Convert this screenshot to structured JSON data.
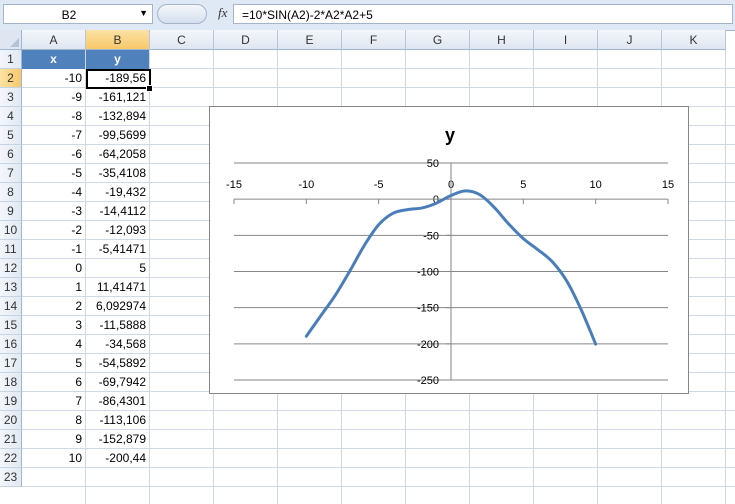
{
  "formula_bar": {
    "name_box": "B2",
    "fx_label": "fx",
    "formula": "=10*SIN(A2)-2*A2*A2+5"
  },
  "columns": [
    "A",
    "B",
    "C",
    "D",
    "E",
    "F",
    "G",
    "H",
    "I",
    "J",
    "K"
  ],
  "selected_column": "B",
  "selected_row": 2,
  "rows": [
    "1",
    "2",
    "3",
    "4",
    "5",
    "6",
    "7",
    "8",
    "9",
    "10",
    "11",
    "12",
    "13",
    "14",
    "15",
    "16",
    "17",
    "18",
    "19",
    "20",
    "21",
    "22",
    "23"
  ],
  "table": {
    "headers": [
      "x",
      "y"
    ],
    "x_values": [
      "-10",
      "-9",
      "-8",
      "-7",
      "-6",
      "-5",
      "-4",
      "-3",
      "-2",
      "-1",
      "0",
      "1",
      "2",
      "3",
      "4",
      "5",
      "6",
      "7",
      "8",
      "9",
      "10"
    ],
    "y_values": [
      "-189,56",
      "-161,121",
      "-132,894",
      "-99,5699",
      "-64,2058",
      "-35,4108",
      "-19,432",
      "-14,4112",
      "-12,093",
      "-5,41471",
      "5",
      "11,41471",
      "6,092974",
      "-11,5888",
      "-34,568",
      "-54,5892",
      "-69,7942",
      "-86,4301",
      "-113,106",
      "-152,879",
      "-200,44"
    ]
  },
  "colors": {
    "header_fill": "#4f81bd",
    "series": "#4a7ebb"
  },
  "chart_data": {
    "type": "scatter",
    "smooth": true,
    "title": "y",
    "xlabel": "",
    "ylabel": "",
    "x": [
      -10,
      -9,
      -8,
      -7,
      -6,
      -5,
      -4,
      -3,
      -2,
      -1,
      0,
      1,
      2,
      3,
      4,
      5,
      6,
      7,
      8,
      9,
      10
    ],
    "y": [
      -189.56,
      -161.121,
      -132.894,
      -99.5699,
      -64.2058,
      -35.4108,
      -19.432,
      -14.4112,
      -12.093,
      -5.41471,
      5,
      11.41471,
      6.092974,
      -11.5888,
      -34.568,
      -54.5892,
      -69.7942,
      -86.4301,
      -113.106,
      -152.879,
      -200.44
    ],
    "xlim": [
      -15,
      15
    ],
    "ylim": [
      -250,
      50
    ],
    "x_ticks": [
      "-15",
      "-10",
      "-5",
      "0",
      "5",
      "10",
      "15"
    ],
    "y_ticks": [
      "50",
      "0",
      "-50",
      "-100",
      "-150",
      "-200",
      "-250"
    ],
    "grid": "horizontal",
    "legend": "none"
  }
}
